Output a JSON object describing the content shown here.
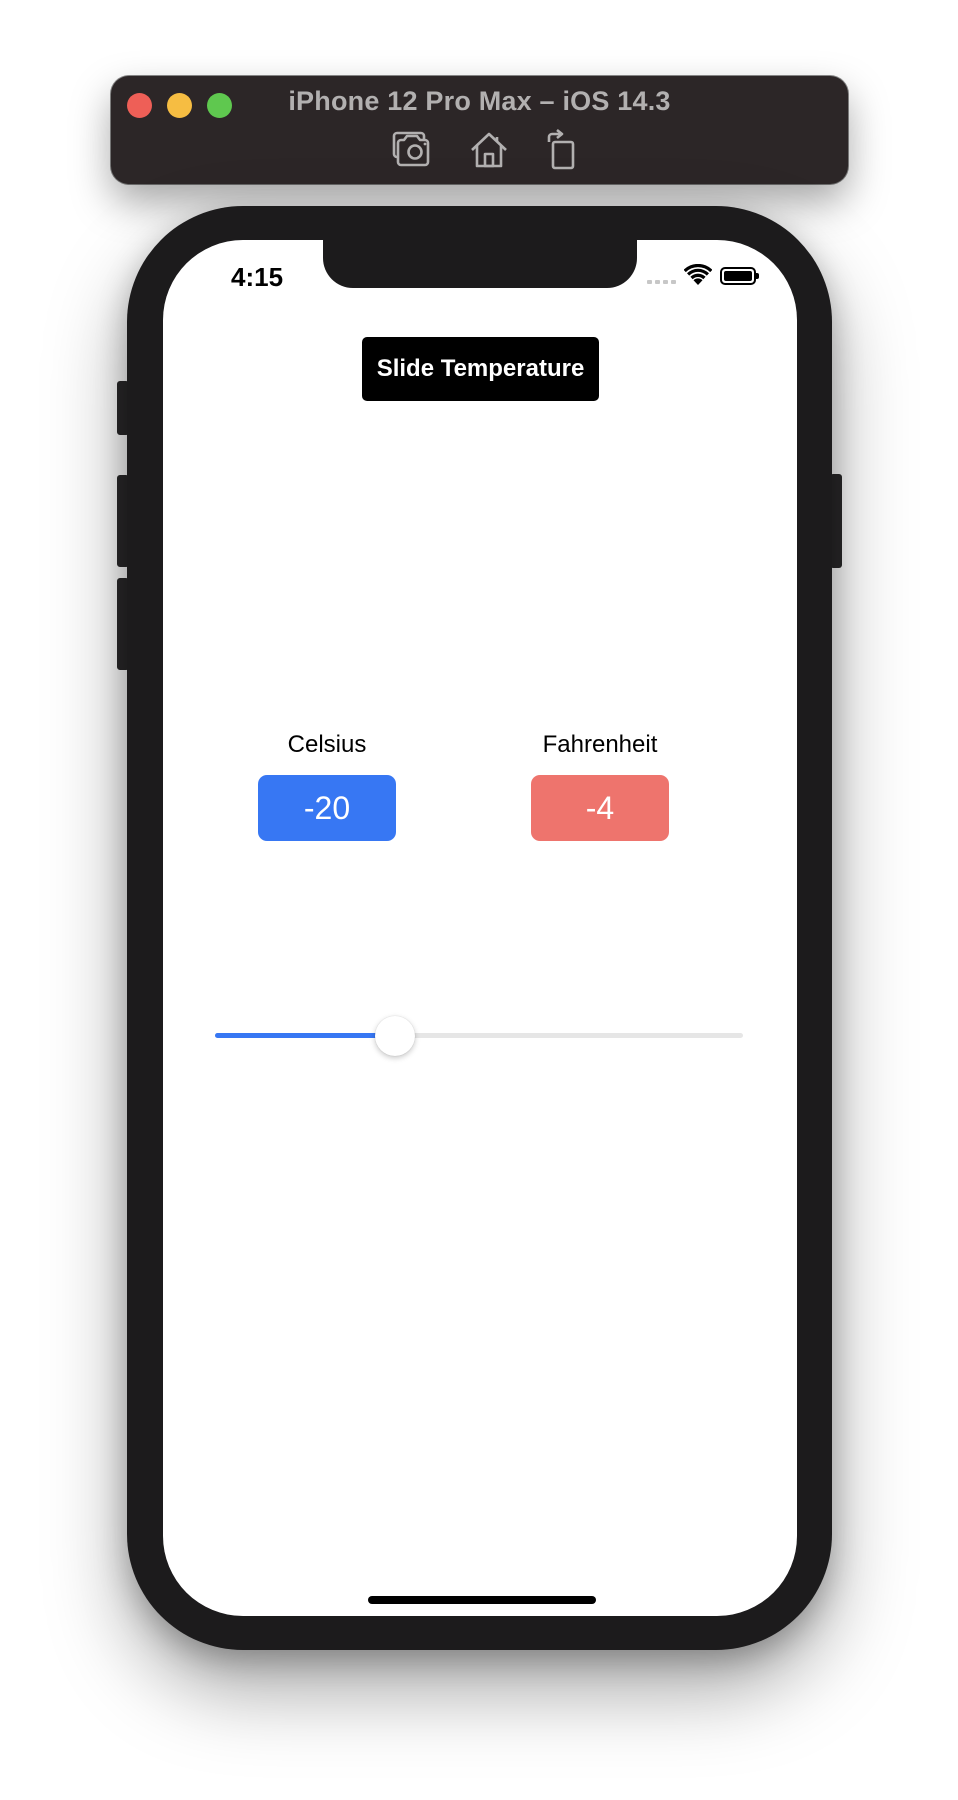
{
  "simulator": {
    "title": "iPhone 12 Pro Max – iOS 14.3",
    "buttons": [
      "screenshot-icon",
      "home-icon",
      "rotate-icon"
    ]
  },
  "status_bar": {
    "time": "4:15",
    "icons": [
      "signal-icon",
      "wifi-icon",
      "battery-icon"
    ]
  },
  "app": {
    "title_button": "Slide Temperature",
    "celsius": {
      "label": "Celsius",
      "value": "-20",
      "color": "#3777f3"
    },
    "fahrenheit": {
      "label": "Fahrenheit",
      "value": "-4",
      "color": "#ee746d"
    },
    "slider": {
      "fraction": 0.34,
      "track_color": "#e6e6e6",
      "fill_color": "#3777f3"
    }
  }
}
